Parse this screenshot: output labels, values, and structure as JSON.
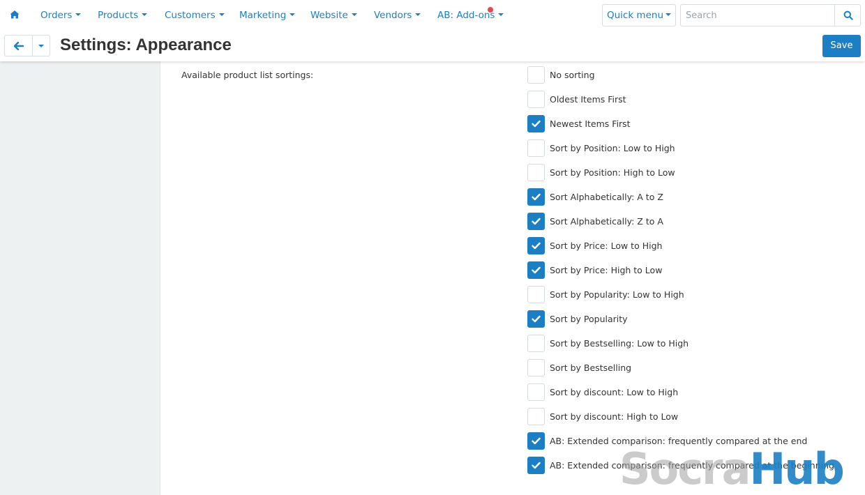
{
  "colors": {
    "accent": "#1c7fc4",
    "sidebar_bg": "#eef1f1",
    "notification_dot": "#e5484d"
  },
  "topnav": {
    "home_icon": "home-icon",
    "items": [
      {
        "label": "Orders"
      },
      {
        "label": "Products"
      },
      {
        "label": "Customers"
      },
      {
        "label": "Marketing"
      },
      {
        "label": "Website"
      },
      {
        "label": "Vendors"
      },
      {
        "label": "AB: Add-ons"
      }
    ],
    "quick_menu_label": "Quick menu",
    "search_placeholder": "Search",
    "search_icon": "search-icon"
  },
  "titlebar": {
    "back_icon": "arrow-left-icon",
    "title": "Settings: Appearance",
    "save_label": "Save"
  },
  "setting": {
    "label": "Available product list sortings:",
    "options": [
      {
        "label": "No sorting",
        "checked": false
      },
      {
        "label": "Oldest Items First",
        "checked": false
      },
      {
        "label": "Newest Items First",
        "checked": true
      },
      {
        "label": "Sort by Position: Low to High",
        "checked": false
      },
      {
        "label": "Sort by Position: High to Low",
        "checked": false
      },
      {
        "label": "Sort Alphabetically: A to Z",
        "checked": true
      },
      {
        "label": "Sort Alphabetically: Z to A",
        "checked": true
      },
      {
        "label": "Sort by Price: Low to High",
        "checked": true
      },
      {
        "label": "Sort by Price: High to Low",
        "checked": true
      },
      {
        "label": "Sort by Popularity: Low to High",
        "checked": false
      },
      {
        "label": "Sort by Popularity",
        "checked": true
      },
      {
        "label": "Sort by Bestselling: Low to High",
        "checked": false
      },
      {
        "label": "Sort by Bestselling",
        "checked": false
      },
      {
        "label": "Sort by discount: Low to High",
        "checked": false
      },
      {
        "label": "Sort by discount: High to Low",
        "checked": false
      },
      {
        "label": "AB: Extended comparison: frequently compared at the end",
        "checked": true
      },
      {
        "label": "AB: Extended comparison: frequently compared at the beginning",
        "checked": true
      }
    ]
  },
  "watermark": {
    "part1": "Socra",
    "part2": "Hub"
  }
}
